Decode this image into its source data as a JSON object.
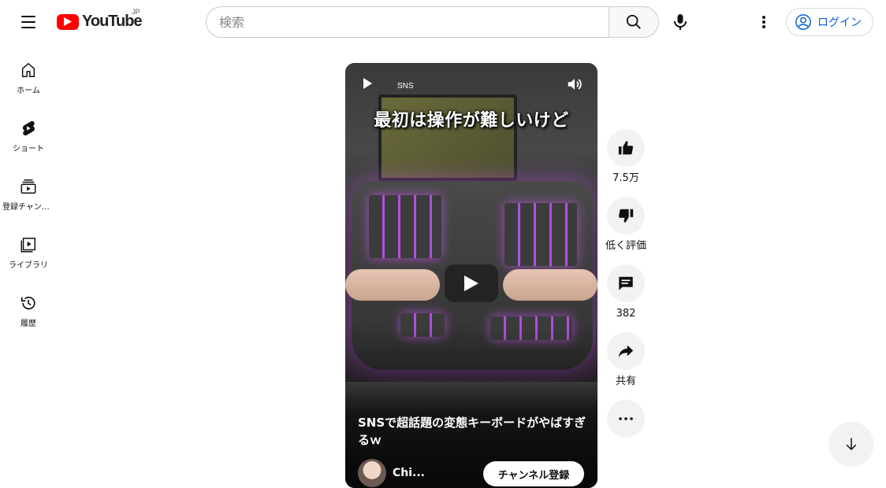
{
  "header": {
    "logo_text": "YouTube",
    "region": "JP",
    "search_placeholder": "検索",
    "login_label": "ログイン"
  },
  "sidebar": {
    "items": [
      {
        "label": "ホーム",
        "icon": "home-icon"
      },
      {
        "label": "ショート",
        "icon": "shorts-icon"
      },
      {
        "label": "登録チャンネル",
        "icon": "subscriptions-icon"
      },
      {
        "label": "ライブラリ",
        "icon": "library-icon"
      },
      {
        "label": "履歴",
        "icon": "history-icon"
      }
    ]
  },
  "video": {
    "badge": "SNS",
    "caption": "最初は操作が難しいけど",
    "title": "SNSで超話題の変態キーボードがやばすぎるｗ",
    "channel": "Chi...",
    "subscribe_label": "チャンネル登録"
  },
  "actions": {
    "like_count": "7.5万",
    "dislike_label": "低く評価",
    "comment_count": "382",
    "share_label": "共有"
  },
  "colors": {
    "brand_red": "#ff0000",
    "link_blue": "#065fd4",
    "button_bg": "#f2f2f2"
  }
}
